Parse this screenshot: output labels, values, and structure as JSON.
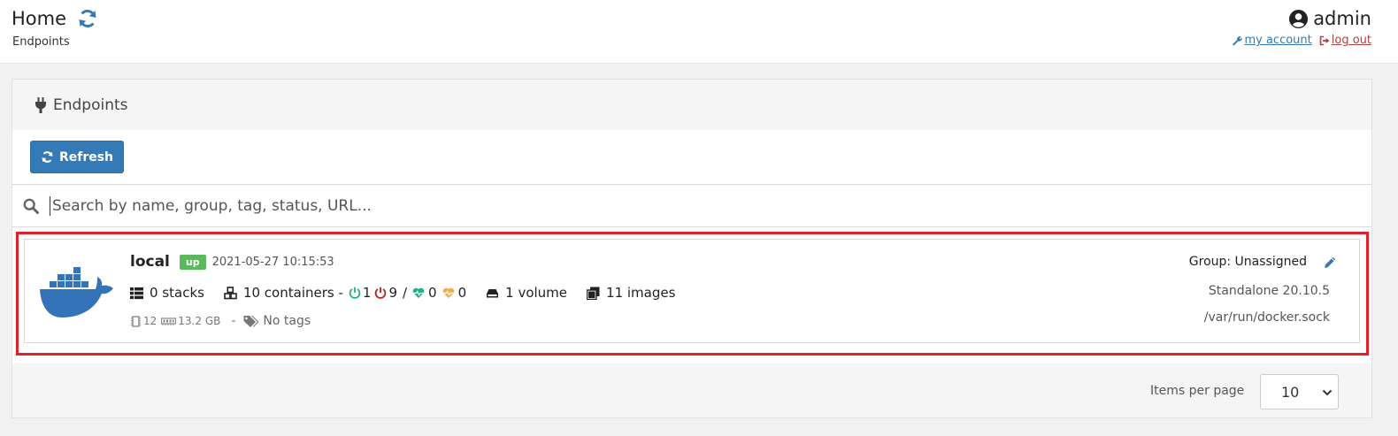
{
  "header": {
    "title": "Home",
    "breadcrumb": "Endpoints",
    "username": "admin",
    "my_account": "my account",
    "log_out": "log out"
  },
  "widget": {
    "title": "Endpoints",
    "refresh_label": "Refresh",
    "search_placeholder": "Search by name, group, tag, status, URL..."
  },
  "endpoints": [
    {
      "name": "local",
      "status": "up",
      "timestamp": "2021-05-27 10:15:53",
      "stacks": "0 stacks",
      "containers": "10 containers -",
      "running": "1",
      "stopped": "9",
      "separator": "/",
      "healthy": "0",
      "unhealthy": "0",
      "volumes": "1 volume",
      "images": "11 images",
      "cpu": "12",
      "memory": "13.2 GB",
      "dash": "-",
      "tags": "No tags",
      "group": "Group: Unassigned",
      "platform": "Standalone 20.10.5",
      "url": "/var/run/docker.sock",
      "logo": "docker-logo"
    }
  ],
  "pagination": {
    "items_per_page_label": "Items per page",
    "items_per_page_value": "10"
  },
  "colors": {
    "primary": "#337ab7",
    "success": "#5cb85c",
    "danger": "#a94442",
    "running": "#23ae89",
    "stopped": "#ae2323",
    "unhealthy": "#f0ad4e",
    "highlight": "#e0202a",
    "docker": "#3473b8"
  },
  "icons": {
    "title_refresh": "refresh-icon",
    "user": "user-circle-icon",
    "account": "wrench-icon",
    "logout": "sign-out-icon",
    "widget": "plug-icon",
    "search": "search-icon",
    "stacks": "th-list-icon",
    "containers": "cubes-icon",
    "running": "power-off-icon",
    "healthy": "heartbeat-icon",
    "volume": "hdd-icon",
    "images": "clone-icon",
    "cpu": "microchip-icon",
    "memory": "memory-icon",
    "tags": "tags-icon",
    "edit": "pencil-icon",
    "select": "chevron-down-icon"
  }
}
